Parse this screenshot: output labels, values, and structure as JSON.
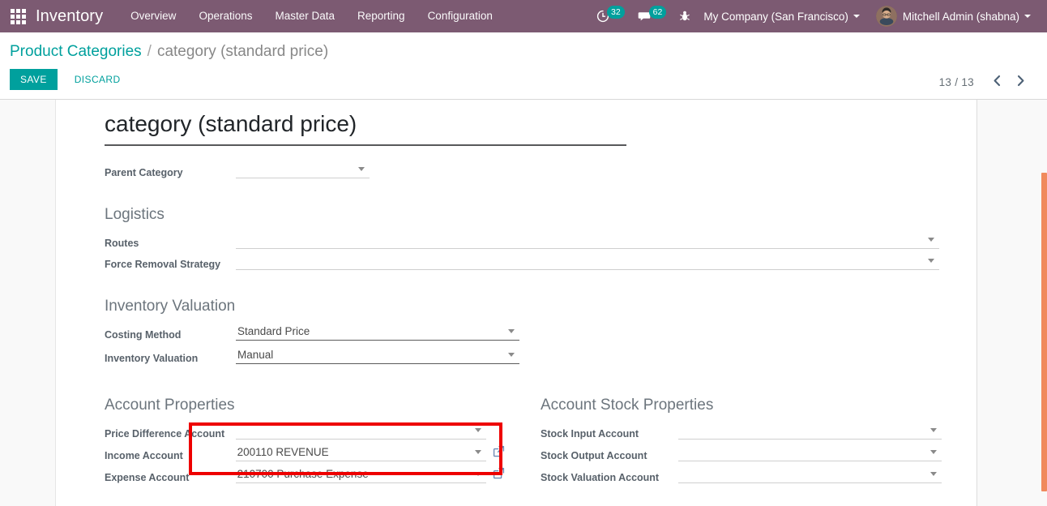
{
  "navbar": {
    "apps_icon": "apps-grid-icon",
    "brand": "Inventory",
    "menu_items": [
      {
        "label": "Overview"
      },
      {
        "label": "Operations"
      },
      {
        "label": "Master Data"
      },
      {
        "label": "Reporting"
      },
      {
        "label": "Configuration"
      }
    ],
    "activities": {
      "icon": "clock-icon",
      "count": "32"
    },
    "messages": {
      "icon": "chat-bubble-icon",
      "count": "62"
    },
    "debug": {
      "icon": "bug-icon"
    },
    "company": "My Company (San Francisco)",
    "user": "Mitchell Admin (shabna)",
    "avatar_icon": "user-avatar"
  },
  "control_panel": {
    "breadcrumb_root": "Product Categories",
    "breadcrumb_sep": "/",
    "breadcrumb_current": "category (standard price)",
    "save_label": "SAVE",
    "discard_label": "DISCARD",
    "pager_value": "13 / 13",
    "pager_prev_icon": "chevron-left-icon",
    "pager_next_icon": "chevron-right-icon"
  },
  "form": {
    "record_title": "category (standard price)",
    "parent_category": {
      "label": "Parent Category",
      "value": ""
    },
    "logistics": {
      "title": "Logistics",
      "fields": [
        {
          "label": "Routes",
          "value": ""
        },
        {
          "label": "Force Removal Strategy",
          "value": ""
        }
      ]
    },
    "inventory_valuation": {
      "title": "Inventory Valuation",
      "fields": [
        {
          "label": "Costing Method",
          "value": "Standard Price"
        },
        {
          "label": "Inventory Valuation",
          "value": "Manual"
        }
      ]
    },
    "account_properties": {
      "title": "Account Properties",
      "fields": [
        {
          "label": "Price Difference Account",
          "value": "",
          "external_link": false
        },
        {
          "label": "Income Account",
          "value": "200110 REVENUE",
          "external_link": true
        },
        {
          "label": "Expense Account",
          "value": "210700 Purchase Expense",
          "external_link": true
        }
      ]
    },
    "account_stock_properties": {
      "title": "Account Stock Properties",
      "fields": [
        {
          "label": "Stock Input Account",
          "value": ""
        },
        {
          "label": "Stock Output Account",
          "value": ""
        },
        {
          "label": "Stock Valuation Account",
          "value": ""
        }
      ]
    }
  },
  "annotation": {
    "highlight_color": "#ee0000",
    "target": "costing-method-and-inventory-valuation-fields"
  },
  "scrollbar": {
    "thumb_color": "#f08a5d"
  },
  "theme": {
    "navbar_bg": "#7c5a72",
    "accent": "#00a09d",
    "page_bg": "#f9f9f9"
  }
}
